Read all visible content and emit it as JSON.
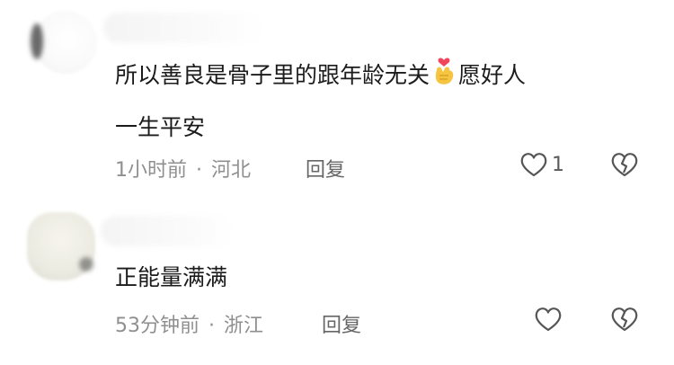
{
  "comments": [
    {
      "text_line1": "所以善良是骨子里的跟年龄无关",
      "emoji": "finger-heart-icon",
      "text_line1_after": "愿好人",
      "text_line2": "一生平安",
      "time": "1小时前",
      "separator": "·",
      "location": "河北",
      "reply_label": "回复",
      "like_count": "1"
    },
    {
      "text_line1": "正能量满满",
      "time": "53分钟前",
      "separator": "·",
      "location": "浙江",
      "reply_label": "回复",
      "like_count": ""
    }
  ]
}
